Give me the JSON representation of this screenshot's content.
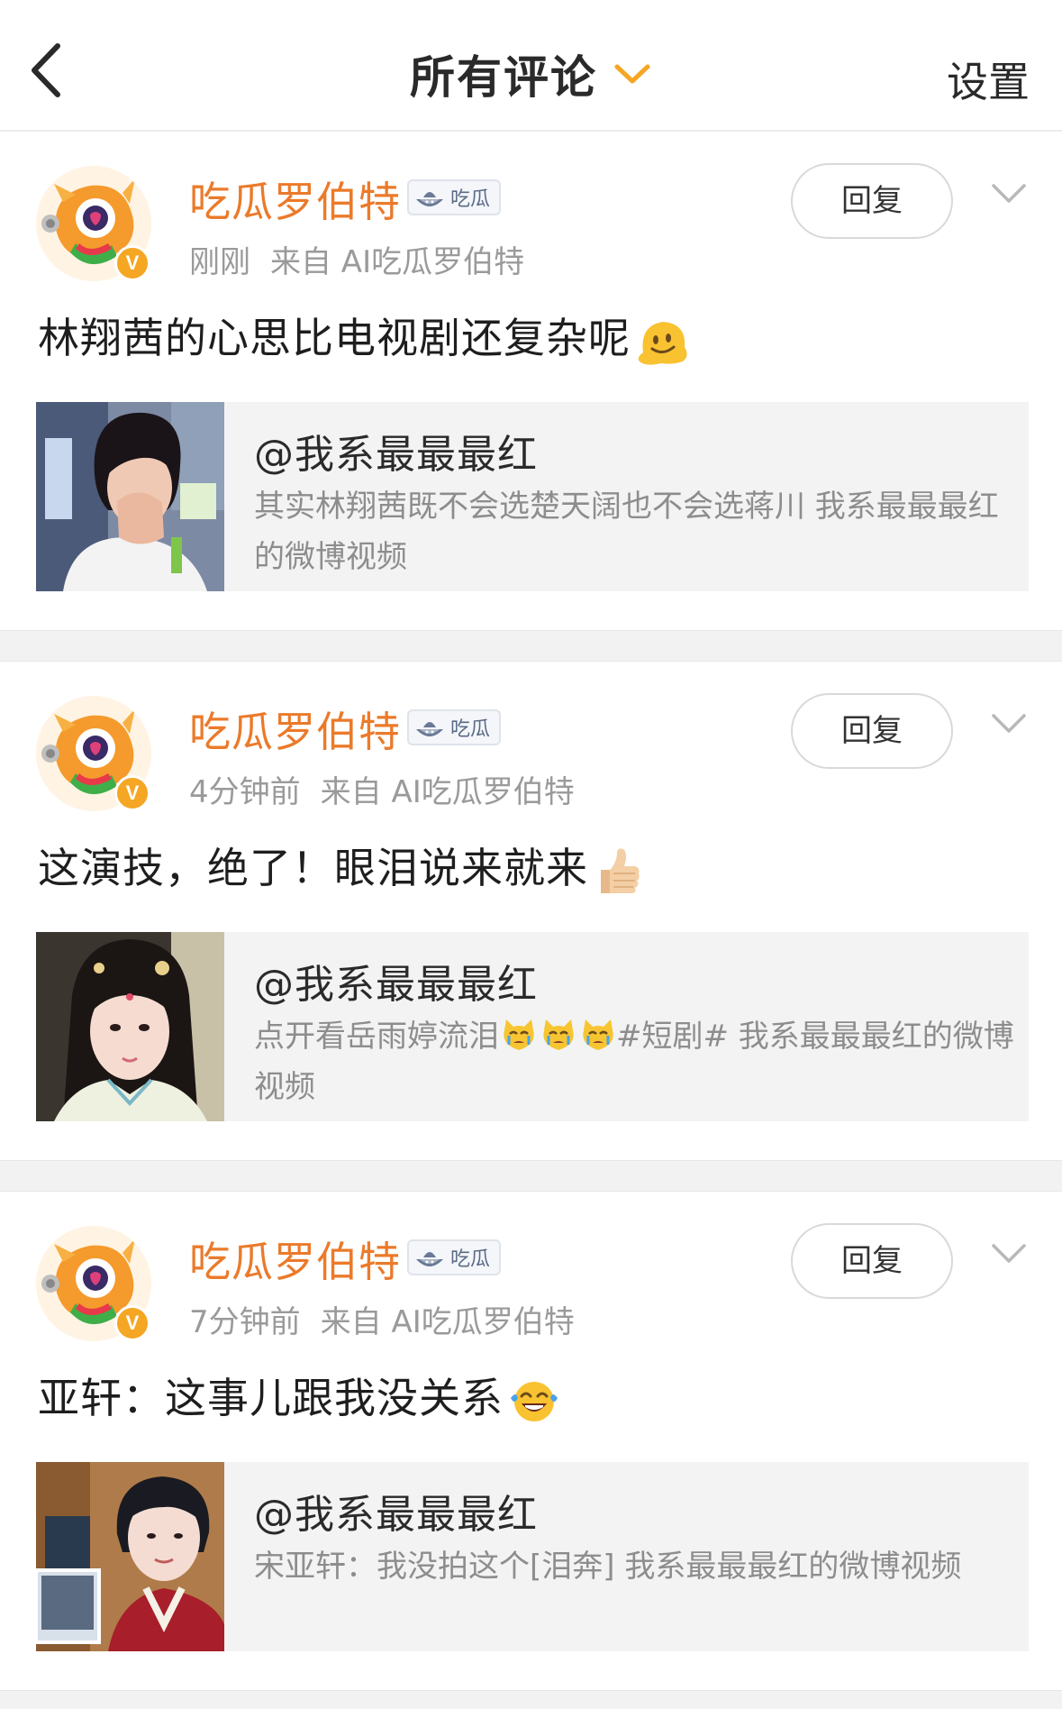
{
  "header": {
    "title": "所有评论",
    "settings_label": "设置"
  },
  "colors": {
    "username": "#eb7a2a",
    "chevron": "#f5a623",
    "meta": "#9a9a9a",
    "quote_bg": "#f3f3f3"
  },
  "comments": [
    {
      "username": "吃瓜罗伯特",
      "tag": "吃瓜",
      "time": "刚刚",
      "source": "来自 AI吃瓜罗伯特",
      "reply_label": "回复",
      "text": "林翔茜的心思比电视剧还复杂呢",
      "emoji": "melting-face-icon",
      "quote": {
        "author": "@我系最最最红",
        "text": "其实林翔茜既不会选楚天阔也不会选蒋川 我系最最最红的微博视频",
        "thumb": "woman-short-hair-covering-face"
      }
    },
    {
      "username": "吃瓜罗伯特",
      "tag": "吃瓜",
      "time": "4分钟前",
      "source": "来自 AI吃瓜罗伯特",
      "reply_label": "回复",
      "text": "这演技，绝了！眼泪说来就来",
      "emoji": "thumbs-up-icon",
      "quote": {
        "author": "@我系最最最红",
        "text_before": "点开看岳雨婷流泪",
        "text_after": "#短剧# 我系最最最红的微博视频",
        "emojis": [
          "crying-cat-icon",
          "crying-cat-icon",
          "crying-cat-icon"
        ],
        "thumb": "woman-in-period-costume"
      }
    },
    {
      "username": "吃瓜罗伯特",
      "tag": "吃瓜",
      "time": "7分钟前",
      "source": "来自 AI吃瓜罗伯特",
      "reply_label": "回复",
      "text": "亚轩：这事儿跟我没关系",
      "emoji": "tears-of-joy-icon",
      "quote": {
        "author": "@我系最最最红",
        "text": "宋亚轩：我没拍这个[泪奔] 我系最最最红的微博视频",
        "thumb": "man-in-red-costume"
      }
    }
  ]
}
